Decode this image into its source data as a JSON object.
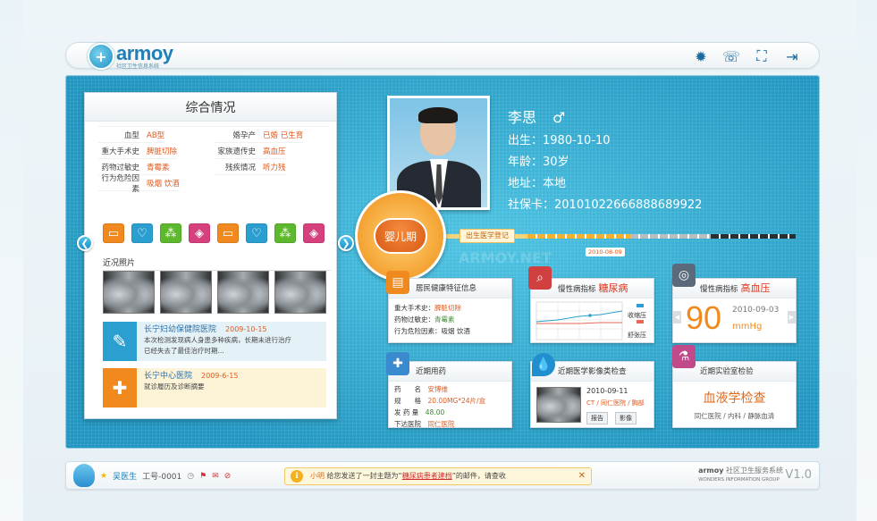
{
  "header": {
    "brand": "armoy",
    "brand_sub": "社区卫生信息系统",
    "icons": [
      "gear-icon",
      "phone-icon",
      "fullscreen-icon",
      "exit-icon"
    ]
  },
  "summary": {
    "title": "综合情况",
    "rows_left": [
      {
        "label": "血型",
        "value": "AB型"
      },
      {
        "label": "重大手术史",
        "value": "脾脏切除"
      },
      {
        "label": "药物过敏史",
        "value": "青霉素"
      },
      {
        "label": "行为危险因素",
        "value": "吸烟 饮酒"
      }
    ],
    "rows_right": [
      {
        "label": "婚孕产",
        "value": "已婚 已生育"
      },
      {
        "label": "家族遗传史",
        "value": "高血压"
      },
      {
        "label": "残疾情况",
        "value": "听力残"
      }
    ],
    "photos_title": "近况照片",
    "records": [
      {
        "title": "长宁妇幼保健院医院",
        "date": "2009-10-15",
        "text1": "本次检测发现病人身患多种疾病，长期未进行治疗",
        "text2": "已经失去了最佳治疗时期..."
      },
      {
        "title": "长宁中心医院",
        "date": "2009-6-15",
        "text1": "就诊履历及诊断摘要",
        "text2": ""
      }
    ]
  },
  "profile": {
    "name": "李思",
    "gender_symbol": "♂",
    "birth": "出生：1980-10-10",
    "age": "年龄：30岁",
    "address": "地址：本地",
    "social_card": "社保卡：20101022666888689922"
  },
  "timeline": {
    "stage": "婴儿期",
    "event_label": "出生医学登记",
    "event_date": "2010-08-09",
    "watermark": "ARMOY.NET"
  },
  "widgets": {
    "health": {
      "title": "居民健康特征信息",
      "rows": [
        {
          "k": "重大手术史：",
          "v": "脾脏切除"
        },
        {
          "k": "药物过敏史：",
          "v": "青霉素"
        },
        {
          "k": "行为危险因素：",
          "v": "吸烟 饮酒"
        }
      ]
    },
    "diabetes": {
      "title": "慢性病指标",
      "emph": "糖尿病",
      "legend1": "收缩压",
      "legend2": "舒张压"
    },
    "hypertension": {
      "title": "慢性病指标",
      "emph": "高血压",
      "value": "90",
      "unit": "mmHg",
      "date": "2010-09-03"
    },
    "meds": {
      "title": "近期用药",
      "rows": [
        {
          "k": "药　　名",
          "v": "安博维"
        },
        {
          "k": "规　　格",
          "v": "20.00MG*24片/盒"
        },
        {
          "k": "发 药 量",
          "v": "48.00"
        },
        {
          "k": "下达医院",
          "v": "同仁医院"
        }
      ]
    },
    "imaging": {
      "title": "近期医学影像类检查",
      "date": "2010-09-11",
      "meta": "CT / 同仁医院 / 胸部",
      "btn1": "报告",
      "btn2": "影像"
    },
    "lab": {
      "title": "近期实验室检验",
      "big": "血液学检查",
      "meta": "同仁医院 / 内科 / 静脉血清"
    }
  },
  "footer": {
    "doctor": "吴医生",
    "doc_id": "工号-0001",
    "notice_sender": "小明",
    "notice_pre": "给您发送了一封主题为“",
    "notice_subject": "糖尿病患者建档",
    "notice_post": "”的邮件，请查收",
    "brand": "armoy",
    "brand_desc": "社区卫生服务系统",
    "brand_en": "WONDERS INFORMATION GROUP",
    "version": "V1.0"
  },
  "colors": {
    "accent": "#2aa6cc",
    "orange": "#e05a1f",
    "blue": "#1f7fb8"
  }
}
